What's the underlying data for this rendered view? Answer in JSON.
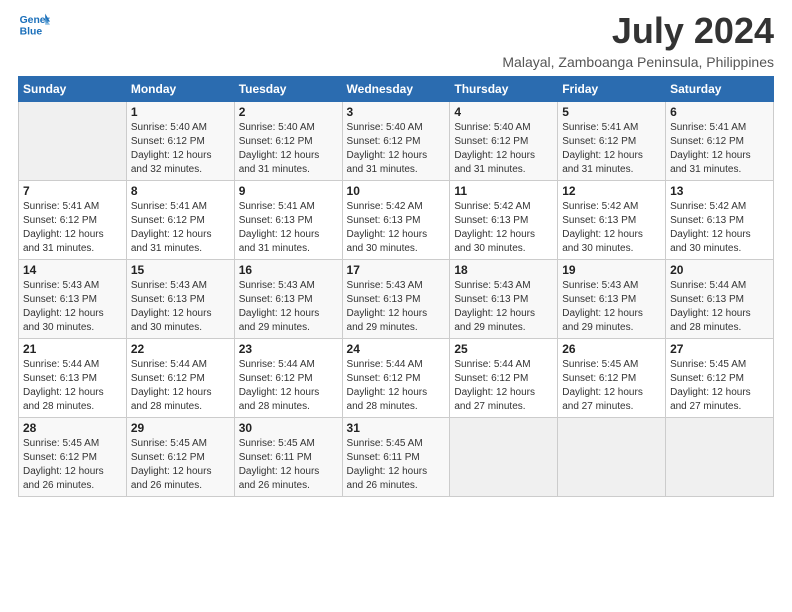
{
  "logo": {
    "line1": "General",
    "line2": "Blue"
  },
  "title": "July 2024",
  "subtitle": "Malayal, Zamboanga Peninsula, Philippines",
  "days_of_week": [
    "Sunday",
    "Monday",
    "Tuesday",
    "Wednesday",
    "Thursday",
    "Friday",
    "Saturday"
  ],
  "weeks": [
    [
      {
        "day": "",
        "info": ""
      },
      {
        "day": "1",
        "info": "Sunrise: 5:40 AM\nSunset: 6:12 PM\nDaylight: 12 hours\nand 32 minutes."
      },
      {
        "day": "2",
        "info": "Sunrise: 5:40 AM\nSunset: 6:12 PM\nDaylight: 12 hours\nand 31 minutes."
      },
      {
        "day": "3",
        "info": "Sunrise: 5:40 AM\nSunset: 6:12 PM\nDaylight: 12 hours\nand 31 minutes."
      },
      {
        "day": "4",
        "info": "Sunrise: 5:40 AM\nSunset: 6:12 PM\nDaylight: 12 hours\nand 31 minutes."
      },
      {
        "day": "5",
        "info": "Sunrise: 5:41 AM\nSunset: 6:12 PM\nDaylight: 12 hours\nand 31 minutes."
      },
      {
        "day": "6",
        "info": "Sunrise: 5:41 AM\nSunset: 6:12 PM\nDaylight: 12 hours\nand 31 minutes."
      }
    ],
    [
      {
        "day": "7",
        "info": "Sunrise: 5:41 AM\nSunset: 6:12 PM\nDaylight: 12 hours\nand 31 minutes."
      },
      {
        "day": "8",
        "info": "Sunrise: 5:41 AM\nSunset: 6:12 PM\nDaylight: 12 hours\nand 31 minutes."
      },
      {
        "day": "9",
        "info": "Sunrise: 5:41 AM\nSunset: 6:13 PM\nDaylight: 12 hours\nand 31 minutes."
      },
      {
        "day": "10",
        "info": "Sunrise: 5:42 AM\nSunset: 6:13 PM\nDaylight: 12 hours\nand 30 minutes."
      },
      {
        "day": "11",
        "info": "Sunrise: 5:42 AM\nSunset: 6:13 PM\nDaylight: 12 hours\nand 30 minutes."
      },
      {
        "day": "12",
        "info": "Sunrise: 5:42 AM\nSunset: 6:13 PM\nDaylight: 12 hours\nand 30 minutes."
      },
      {
        "day": "13",
        "info": "Sunrise: 5:42 AM\nSunset: 6:13 PM\nDaylight: 12 hours\nand 30 minutes."
      }
    ],
    [
      {
        "day": "14",
        "info": "Sunrise: 5:43 AM\nSunset: 6:13 PM\nDaylight: 12 hours\nand 30 minutes."
      },
      {
        "day": "15",
        "info": "Sunrise: 5:43 AM\nSunset: 6:13 PM\nDaylight: 12 hours\nand 30 minutes."
      },
      {
        "day": "16",
        "info": "Sunrise: 5:43 AM\nSunset: 6:13 PM\nDaylight: 12 hours\nand 29 minutes."
      },
      {
        "day": "17",
        "info": "Sunrise: 5:43 AM\nSunset: 6:13 PM\nDaylight: 12 hours\nand 29 minutes."
      },
      {
        "day": "18",
        "info": "Sunrise: 5:43 AM\nSunset: 6:13 PM\nDaylight: 12 hours\nand 29 minutes."
      },
      {
        "day": "19",
        "info": "Sunrise: 5:43 AM\nSunset: 6:13 PM\nDaylight: 12 hours\nand 29 minutes."
      },
      {
        "day": "20",
        "info": "Sunrise: 5:44 AM\nSunset: 6:13 PM\nDaylight: 12 hours\nand 28 minutes."
      }
    ],
    [
      {
        "day": "21",
        "info": "Sunrise: 5:44 AM\nSunset: 6:13 PM\nDaylight: 12 hours\nand 28 minutes."
      },
      {
        "day": "22",
        "info": "Sunrise: 5:44 AM\nSunset: 6:12 PM\nDaylight: 12 hours\nand 28 minutes."
      },
      {
        "day": "23",
        "info": "Sunrise: 5:44 AM\nSunset: 6:12 PM\nDaylight: 12 hours\nand 28 minutes."
      },
      {
        "day": "24",
        "info": "Sunrise: 5:44 AM\nSunset: 6:12 PM\nDaylight: 12 hours\nand 28 minutes."
      },
      {
        "day": "25",
        "info": "Sunrise: 5:44 AM\nSunset: 6:12 PM\nDaylight: 12 hours\nand 27 minutes."
      },
      {
        "day": "26",
        "info": "Sunrise: 5:45 AM\nSunset: 6:12 PM\nDaylight: 12 hours\nand 27 minutes."
      },
      {
        "day": "27",
        "info": "Sunrise: 5:45 AM\nSunset: 6:12 PM\nDaylight: 12 hours\nand 27 minutes."
      }
    ],
    [
      {
        "day": "28",
        "info": "Sunrise: 5:45 AM\nSunset: 6:12 PM\nDaylight: 12 hours\nand 26 minutes."
      },
      {
        "day": "29",
        "info": "Sunrise: 5:45 AM\nSunset: 6:12 PM\nDaylight: 12 hours\nand 26 minutes."
      },
      {
        "day": "30",
        "info": "Sunrise: 5:45 AM\nSunset: 6:11 PM\nDaylight: 12 hours\nand 26 minutes."
      },
      {
        "day": "31",
        "info": "Sunrise: 5:45 AM\nSunset: 6:11 PM\nDaylight: 12 hours\nand 26 minutes."
      },
      {
        "day": "",
        "info": ""
      },
      {
        "day": "",
        "info": ""
      },
      {
        "day": "",
        "info": ""
      }
    ]
  ]
}
